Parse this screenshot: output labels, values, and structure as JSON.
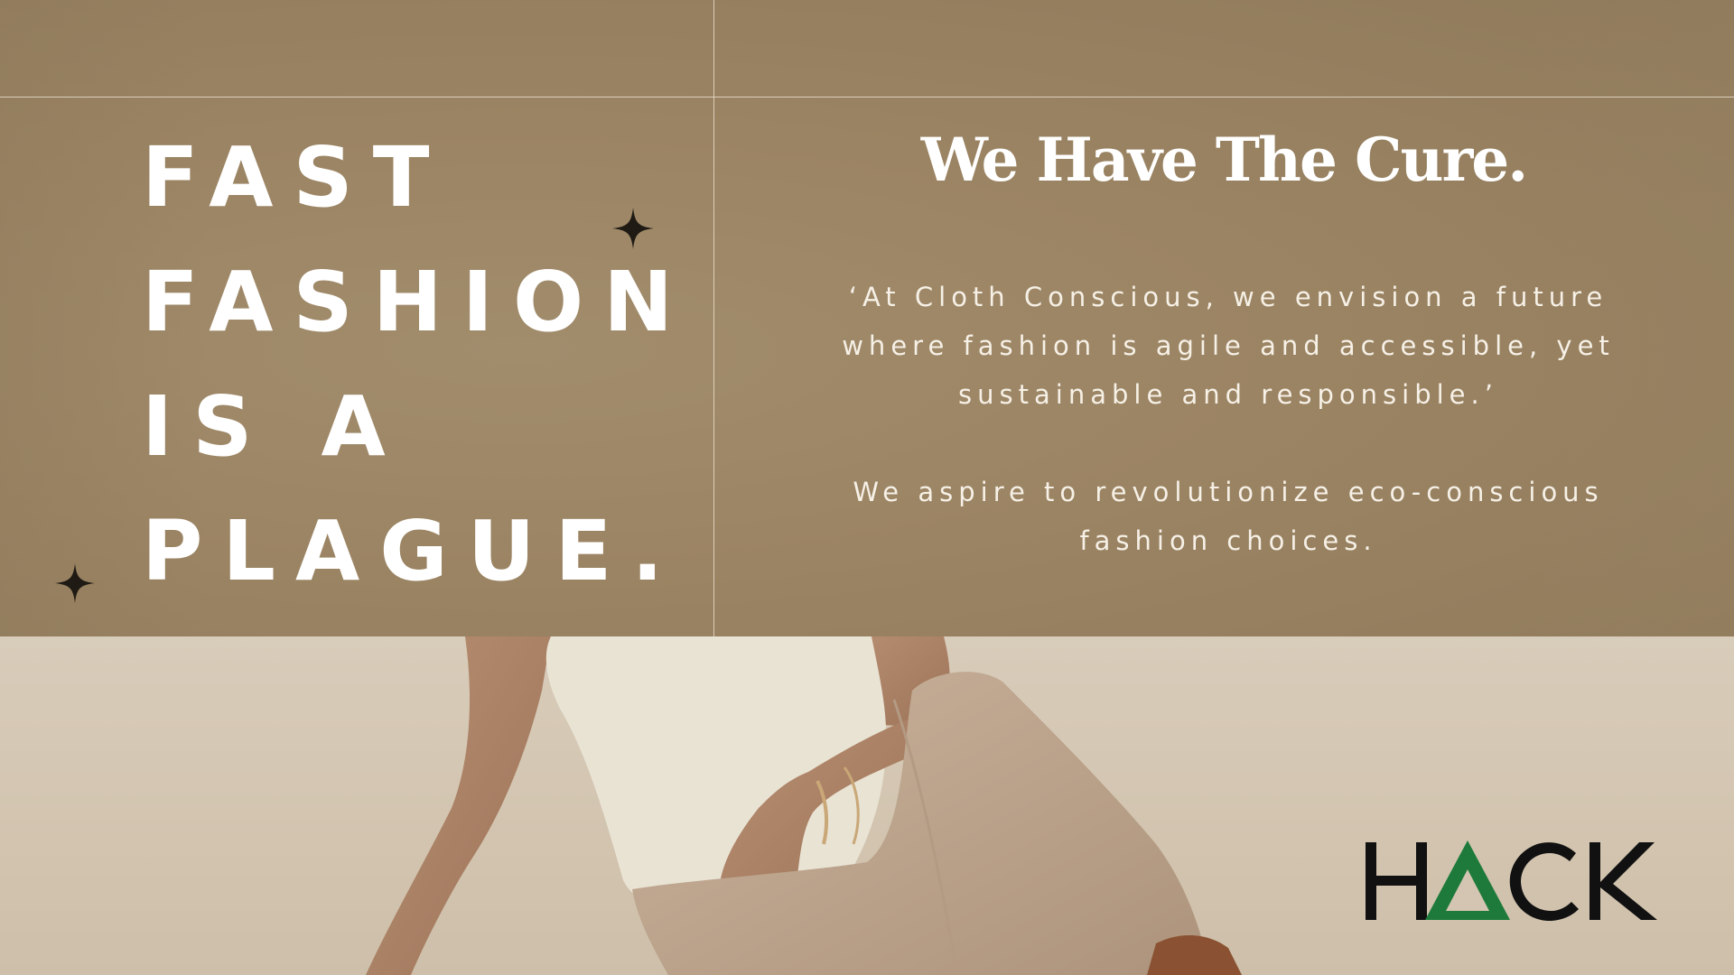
{
  "headline": {
    "line1": "FAST",
    "line2": "FASHION",
    "line3": "IS A",
    "line4": "PLAGUE."
  },
  "cure_title": "We Have The Cure.",
  "paragraph1": "‘At Cloth Conscious, we envision a future where fashion is agile and accessible, yet sustainable and responsible.’",
  "paragraph2": "We aspire to revolutionize eco-conscious fashion choices.",
  "logo": {
    "text": "HACK",
    "colors": {
      "letters": "#111111",
      "triangle": "#1d7a3a"
    }
  },
  "colors": {
    "panel": "#9b8463",
    "photo_background": "#d3c5b1",
    "text": "#ffffff"
  },
  "icons": [
    "sparkle-icon",
    "sparkle-icon"
  ]
}
